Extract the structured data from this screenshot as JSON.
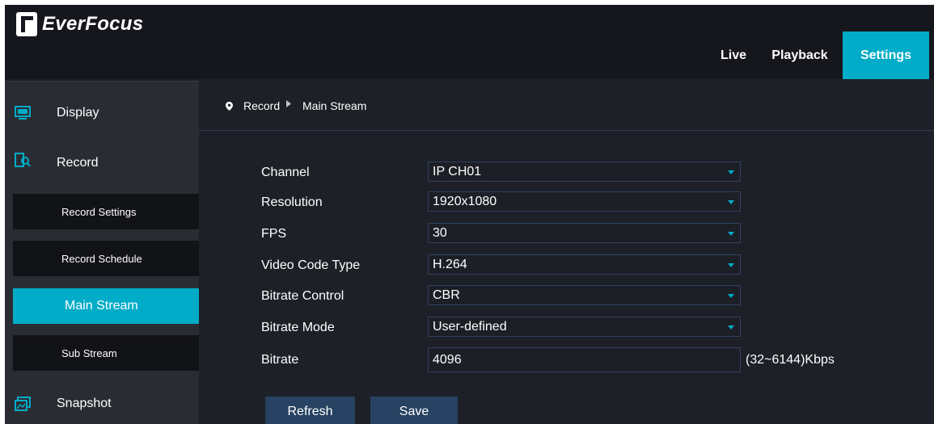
{
  "brand": {
    "name": "EverFocus"
  },
  "nav": {
    "tabs": [
      "Live",
      "Playback",
      "Settings"
    ],
    "active": "Settings"
  },
  "sidebar": {
    "categories": [
      {
        "label": "Display",
        "icon": "monitor-icon"
      },
      {
        "label": "Record",
        "icon": "record-search-icon"
      },
      {
        "label": "Snapshot",
        "icon": "snapshot-image-icon"
      }
    ],
    "record_items": [
      "Record Settings",
      "Record Schedule",
      "Main Stream",
      "Sub Stream"
    ],
    "active_item": "Main Stream"
  },
  "breadcrumb": {
    "section": "Record",
    "page": "Main Stream"
  },
  "form": {
    "channel": {
      "label": "Channel",
      "value": "IP CH01"
    },
    "resolution": {
      "label": "Resolution",
      "value": "1920x1080"
    },
    "fps": {
      "label": "FPS",
      "value": "30"
    },
    "video_code_type": {
      "label": "Video Code Type",
      "value": "H.264"
    },
    "bitrate_control": {
      "label": "Bitrate Control",
      "value": "CBR"
    },
    "bitrate_mode": {
      "label": "Bitrate Mode",
      "value": "User-defined"
    },
    "bitrate": {
      "label": "Bitrate",
      "value": "4096",
      "range_hint": "(32~6144)Kbps"
    }
  },
  "buttons": {
    "refresh": "Refresh",
    "save": "Save"
  },
  "colors": {
    "accent": "#00acc8",
    "button": "#274262",
    "header": "#15171c",
    "sidebar": "#2a2c33",
    "main": "#1e2027"
  }
}
